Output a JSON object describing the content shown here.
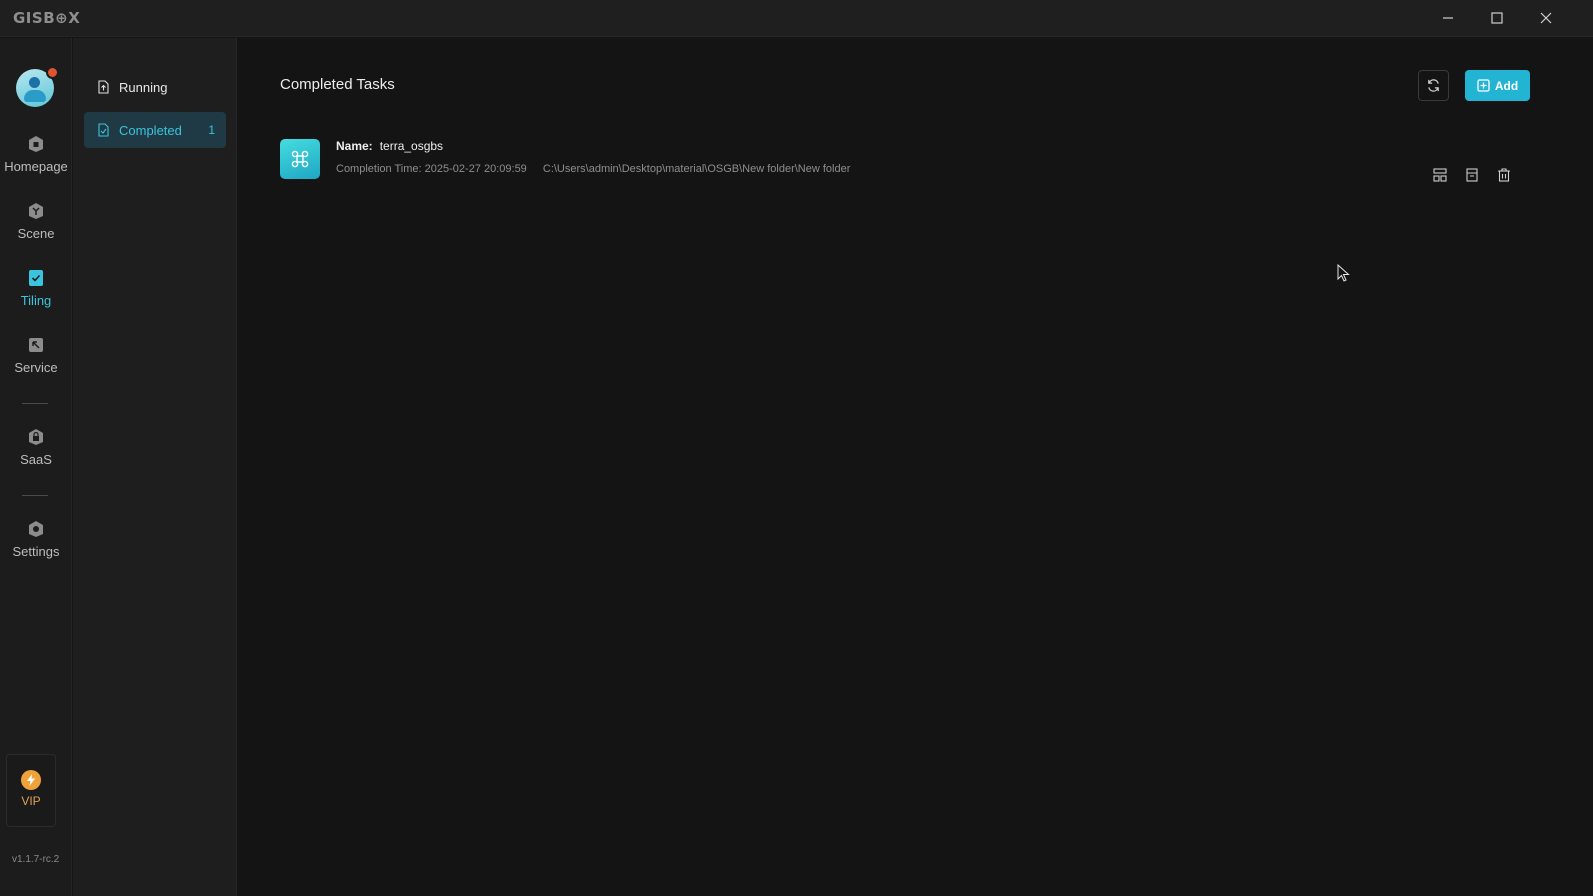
{
  "app": {
    "logo": "GISB⊕X",
    "version": "v1.1.7-rc.2"
  },
  "window_controls": {
    "minimize": "minimize-icon",
    "maximize": "maximize-icon",
    "close": "close-icon"
  },
  "rail": {
    "items": [
      {
        "label": "Homepage",
        "icon": "home-icon"
      },
      {
        "label": "Scene",
        "icon": "scene-icon"
      },
      {
        "label": "Tiling",
        "icon": "tiling-icon",
        "active": true
      },
      {
        "label": "Service",
        "icon": "service-icon"
      },
      {
        "label": "SaaS",
        "icon": "lock-icon"
      },
      {
        "label": "Settings",
        "icon": "gear-icon"
      }
    ],
    "vip": {
      "label": "VIP",
      "icon": "bolt-icon"
    }
  },
  "subnav": {
    "items": [
      {
        "label": "Running",
        "icon": "upload-doc-icon"
      },
      {
        "label": "Completed",
        "icon": "check-doc-icon",
        "count": "1",
        "active": true
      }
    ]
  },
  "main": {
    "title": "Completed Tasks",
    "add_label": "Add",
    "tasks": [
      {
        "name_key": "Name:",
        "name": "terra_osgbs",
        "completion_label": "Completion Time:",
        "completion_time": "2025-02-27 20:09:59",
        "path": "C:\\Users\\admin\\Desktop\\material\\OSGB\\New folder\\New folder"
      }
    ]
  },
  "colors": {
    "accent": "#22b4d2",
    "active_text": "#3bc4dd",
    "vip": "#f0a23a",
    "badge": "#e0552d"
  }
}
